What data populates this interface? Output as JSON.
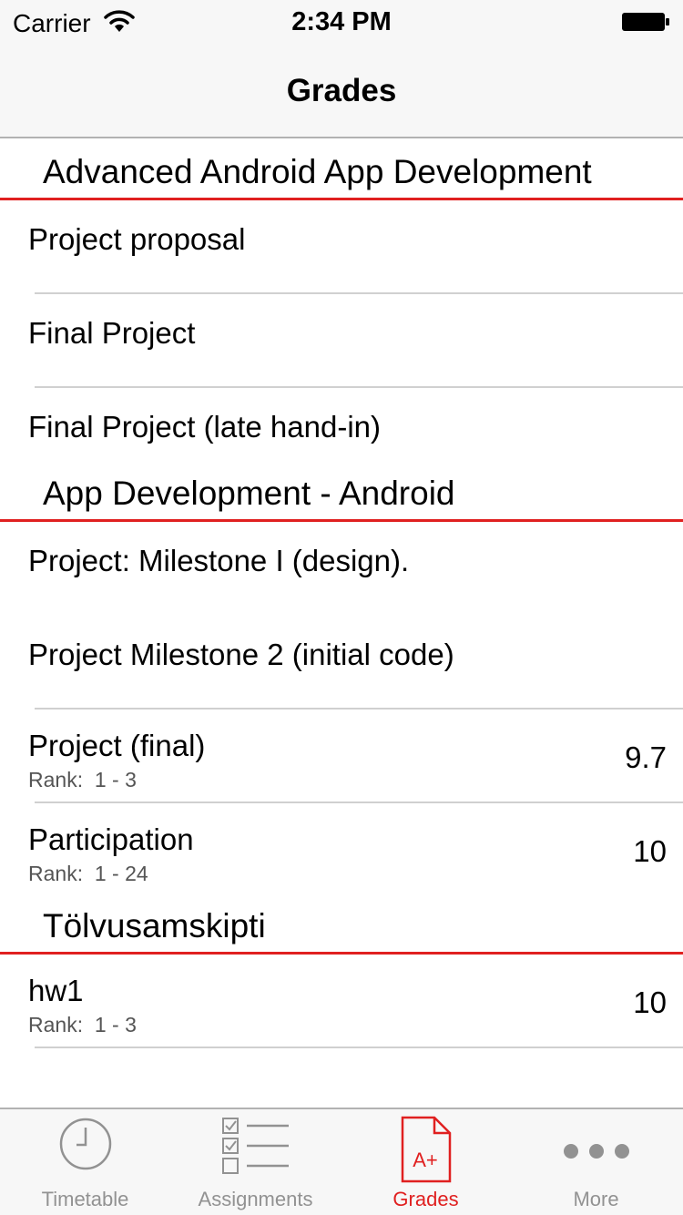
{
  "status_bar": {
    "carrier": "Carrier",
    "time": "2:34 PM"
  },
  "nav": {
    "title": "Grades"
  },
  "accent_color": "#e02020",
  "sections": [
    {
      "title": "Advanced Android App Development",
      "rows": [
        {
          "title": "Project proposal"
        },
        {
          "title": "Final Project"
        },
        {
          "title": "Final Project (late hand-in)"
        }
      ]
    },
    {
      "title": "App Development - Android",
      "rows": [
        {
          "title": "Project: Milestone I (design)."
        },
        {
          "title": "Project Milestone 2 (initial code)"
        },
        {
          "title": "Project (final)",
          "rank": "Rank:  1 - 3",
          "grade": "9.7"
        },
        {
          "title": "Participation",
          "rank": "Rank:  1 - 24",
          "grade": "10"
        }
      ]
    },
    {
      "title": "Tölvusamskipti",
      "rows": [
        {
          "title": "hw1",
          "rank": "Rank:  1 - 3",
          "grade": "10"
        }
      ]
    }
  ],
  "tabs": [
    {
      "label": "Timetable",
      "icon": "clock-icon",
      "active": false
    },
    {
      "label": "Assignments",
      "icon": "checklist-icon",
      "active": false
    },
    {
      "label": "Grades",
      "icon": "grade-document-icon",
      "active": true
    },
    {
      "label": "More",
      "icon": "more-dots-icon",
      "active": false
    }
  ]
}
